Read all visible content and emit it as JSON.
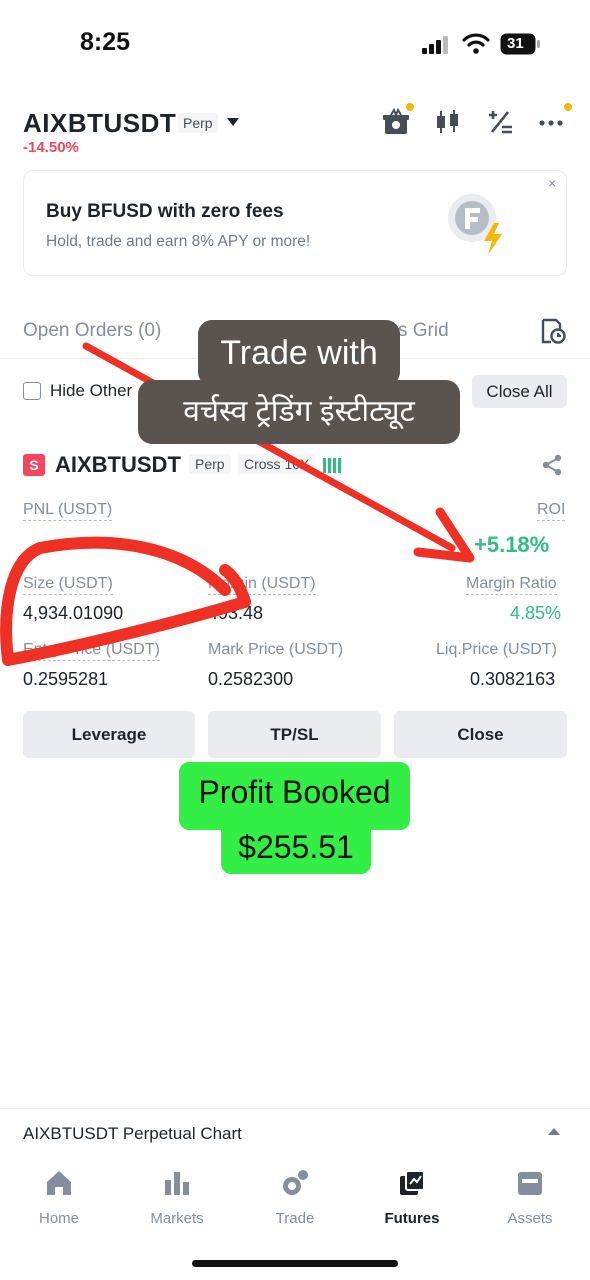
{
  "status_bar": {
    "time": "8:25",
    "battery": "31"
  },
  "header": {
    "symbol": "AIXBTUSDT",
    "contract_tag": "Perp",
    "change": "-14.50%",
    "icons": [
      "gift-icon",
      "candlestick-icon",
      "calculator-icon",
      "more-icon"
    ]
  },
  "banner": {
    "title": "Buy BFUSD with zero fees",
    "subtitle": "Hold, trade and earn 8% APY or more!",
    "close": "×"
  },
  "tabs": [
    {
      "label": "Open Orders (0)"
    },
    {
      "label": "s Grid"
    }
  ],
  "filters": {
    "hide_other": "Hide Other",
    "close_all": "Close All"
  },
  "overlay": {
    "line1": "Trade with",
    "line2": "वर्चस्व ट्रेडिंग इंस्टीट्यूट",
    "profit_line1": "Profit Booked",
    "profit_line2": "$255.51"
  },
  "position": {
    "side_badge": "S",
    "symbol": "AIXBTUSDT",
    "contract_tag": "Perp",
    "margin_tag": "Cross 10X",
    "pnl_label": "PNL (USDT)",
    "roi_label": "ROI",
    "roi_value": "+5.18%",
    "size_label": "Size (USDT)",
    "size_value": "4,934.01090",
    "margin_label": "Margin (USDT)",
    "margin_value": "493.48",
    "margin_ratio_label": "Margin Ratio",
    "margin_ratio_value": "4.85%",
    "entry_label": "Entry Price (USDT)",
    "entry_value": "0.2595281",
    "mark_label": "Mark Price (USDT)",
    "mark_value": "0.2582300",
    "liq_label": "Liq.Price (USDT)",
    "liq_value": "0.3082163",
    "buttons": {
      "leverage": "Leverage",
      "tpsl": "TP/SL",
      "close": "Close"
    }
  },
  "chart_bar": {
    "title": "AIXBTUSDT Perpetual  Chart"
  },
  "bottom_nav": [
    {
      "label": "Home",
      "icon": "home-icon"
    },
    {
      "label": "Markets",
      "icon": "markets-icon"
    },
    {
      "label": "Trade",
      "icon": "trade-icon"
    },
    {
      "label": "Futures",
      "icon": "futures-icon",
      "active": true
    },
    {
      "label": "Assets",
      "icon": "assets-icon"
    }
  ],
  "colors": {
    "red": "#f6465d",
    "green": "#2ebd85",
    "accent": "#f0b90b",
    "annotation_red": "#ee3124",
    "promo_bg": "#5a5450",
    "profit_bg": "#33ee44"
  }
}
